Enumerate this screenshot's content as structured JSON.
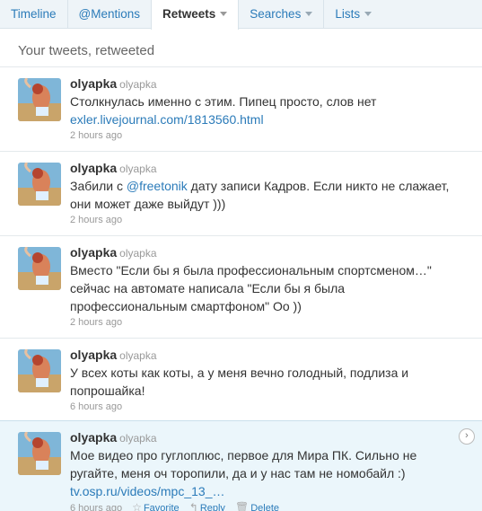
{
  "tabs": [
    {
      "label": "Timeline",
      "dropdown": false,
      "active": false
    },
    {
      "label": "@Mentions",
      "dropdown": false,
      "active": false
    },
    {
      "label": "Retweets",
      "dropdown": true,
      "active": true
    },
    {
      "label": "Searches",
      "dropdown": true,
      "active": false
    },
    {
      "label": "Lists",
      "dropdown": true,
      "active": false
    }
  ],
  "heading": "Your tweets, retweeted",
  "colors": {
    "link": "#2b7bb9",
    "highlight_bg": "#ebf6fb",
    "tab_bar_bg": "#eef4f8"
  },
  "tweets": [
    {
      "screen_name": "olyapka",
      "full_name": "olyapka",
      "text_before": "Столкнулась именно с этим. Пипец просто, слов нет ",
      "mention": "",
      "text_after": "",
      "link": "exler.livejournal.com/1813560.html",
      "time": "2 hours ago"
    },
    {
      "screen_name": "olyapka",
      "full_name": "olyapka",
      "text_before": "Забили с ",
      "mention": "@freetonik",
      "text_after": " дату записи Кадров. Если никто не слажает, они может даже выйдут )))",
      "link": "",
      "time": "2 hours ago"
    },
    {
      "screen_name": "olyapka",
      "full_name": "olyapka",
      "text_before": "Вместо \"Если бы я была профессиональным спортсменом…\" сейчас на автомате написала \"Если бы я была профессиональным смартфоном\" Оо ))",
      "mention": "",
      "text_after": "",
      "link": "",
      "time": "2 hours ago"
    },
    {
      "screen_name": "olyapka",
      "full_name": "olyapka",
      "text_before": "У всех коты как коты, а у меня вечно голодный, подлиза и попрошайка!",
      "mention": "",
      "text_after": "",
      "link": "",
      "time": "6 hours ago"
    },
    {
      "screen_name": "olyapka",
      "full_name": "olyapka",
      "text_before": "Мое видео про гуглоплюс, первое для Мира ПК. Сильно не ругайте, меня оч торопили, да и у нас там не номобайл :) ",
      "mention": "",
      "text_after": "",
      "link": "tv.osp.ru/videos/mpc_13_…",
      "time": "6 hours ago",
      "actions": {
        "favorite": "Favorite",
        "reply": "Reply",
        "delete": "Delete"
      },
      "icons": {
        "favorite": "star-icon",
        "reply": "reply-arrow-icon",
        "delete": "trash-icon",
        "expand": "chevron-right-icon"
      }
    }
  ]
}
